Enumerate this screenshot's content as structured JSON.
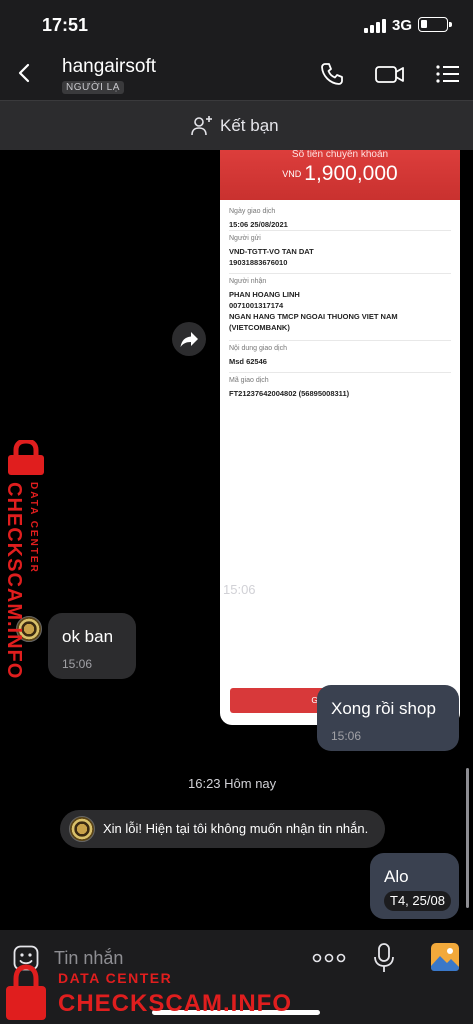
{
  "status_bar": {
    "time": "17:51",
    "network": "3G"
  },
  "header": {
    "name": "hangairsoft",
    "badge": "NGƯỜI LẠ"
  },
  "add_friend": {
    "label": "Kết bạn"
  },
  "receipt": {
    "amount_label": "Số tiền chuyển khoản",
    "currency": "VND",
    "amount": "1,900,000",
    "fields": [
      {
        "label": "Ngày giao dịch",
        "value": "15:06 25/08/2021"
      },
      {
        "label": "Người gửi",
        "value": "VND-TGTT-VO TAN DAT\n19031883676010"
      },
      {
        "label": "Người nhận",
        "value": "PHAN HOANG LINH\n0071001317174\nNGAN HANG TMCP NGOAI THUONG VIET NAM\n(VIETCOMBANK)"
      },
      {
        "label": "Nội dung giao dịch",
        "value": "Msd 62546"
      },
      {
        "label": "Mã giao dịch",
        "value": "FT21237642004802 (56895008311)"
      }
    ],
    "button": "Giao dịch khác"
  },
  "messages": {
    "receipt_time": "15:06",
    "m1": {
      "text": "ok ban",
      "time": "15:06"
    },
    "m2": {
      "text": "Xong rồi shop",
      "time": "15:06"
    },
    "divider": "16:23 Hôm nay",
    "system": "Xin lỗi! Hiện tại tôi không muốn nhận tin nhắn.",
    "m3": {
      "text": "Alo",
      "date": "T4, 25/08"
    }
  },
  "composer": {
    "placeholder": "Tin nhắn"
  },
  "watermark": {
    "brand": "CHECKSCAM.INFO",
    "sub": "DATA CENTER"
  },
  "colors": {
    "accent_red": "#e01e1e",
    "bubble_me": "#3a4150",
    "bubble_other": "#2c2c2e"
  }
}
